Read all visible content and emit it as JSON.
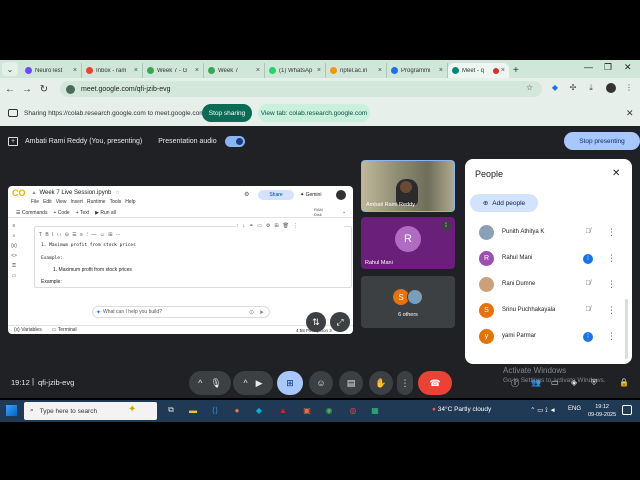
{
  "browser": {
    "tabs": [
      {
        "title": "NeuroTest",
        "fav": "#6d4aff"
      },
      {
        "title": "Inbox - ram",
        "fav": "#ea4335"
      },
      {
        "title": "Week 7 - G",
        "fav": "#34a853"
      },
      {
        "title": "Week 7",
        "fav": "#34a853"
      },
      {
        "title": "(1) WhatsAp",
        "fav": "#25d366"
      },
      {
        "title": "nptel.ac.in",
        "fav": "#f29900"
      },
      {
        "title": "Programmi",
        "fav": "#1a73e8"
      },
      {
        "title": "Meet - q",
        "fav": "#00897b"
      }
    ],
    "url": "meet.google.com/qfi-jzib-evg"
  },
  "sharing_bar": {
    "message": "Sharing https://colab.research.google.com to meet.google.com",
    "stop_sharing": "Stop sharing",
    "view_tab": "View tab: colab.research.google.com"
  },
  "presenting": {
    "name": "Ambati Rami Reddy (You, presenting)",
    "audio_label": "Presentation audio",
    "stop_presenting": "Stop presenting"
  },
  "colab": {
    "notebook_title": "Week 7 Live Session.ipynb",
    "menu": [
      "File",
      "Edit",
      "View",
      "Insert",
      "Runtime",
      "Tools",
      "Help"
    ],
    "share_label": "Share",
    "gemini_label": "Gemini",
    "tools": [
      "Commands",
      "+ Code",
      "+ Text",
      "▶ Run all"
    ],
    "ram_label": "RAM",
    "disk_label": "Disk",
    "md_source_line1": "1. Maximum profit from stock prices",
    "md_source_line2": "Example:",
    "rendered_li": "1. Maximum profit from stock prices",
    "rendered_example": "Example:",
    "gemini_prompt": "What can I help you build?",
    "status_variables": "Variables",
    "status_terminal": "Terminal",
    "status_right": "4:58 PM  Python 3"
  },
  "tiles": {
    "ambati_name": "Ambati Rami Reddy",
    "rahul_initial": "R",
    "rahul_name": "Rahul Mani",
    "others_initial": "S",
    "others_label": "6 others"
  },
  "people_panel": {
    "title": "People",
    "add_people": "Add people",
    "participants": [
      {
        "name": "Punith Athitya K",
        "initial": "",
        "color": "#8a9fb8",
        "mic": "muted"
      },
      {
        "name": "Rahul Mani",
        "initial": "R",
        "color": "#9c4fb0",
        "mic": "speaking"
      },
      {
        "name": "Rani Dumne",
        "initial": "",
        "color": "#c9a27a",
        "mic": "muted"
      },
      {
        "name": "Srinu Puchhakayala",
        "initial": "S",
        "color": "#e8710a",
        "mic": "muted"
      },
      {
        "name": "yami Parmar",
        "initial": "y",
        "color": "#e37400",
        "mic": "speaking"
      }
    ]
  },
  "bottom_bar": {
    "time": "19:12",
    "meeting_code": "qfi-jzib-evg"
  },
  "watermark": {
    "line1": "Activate Windows",
    "line2": "Go to Settings to activate Windows."
  },
  "taskbar": {
    "search_placeholder": "Type here to search",
    "weather": "34°C  Partly cloudy",
    "language": "ENG",
    "clock_time": "19:12",
    "clock_date": "09-09-2025"
  }
}
